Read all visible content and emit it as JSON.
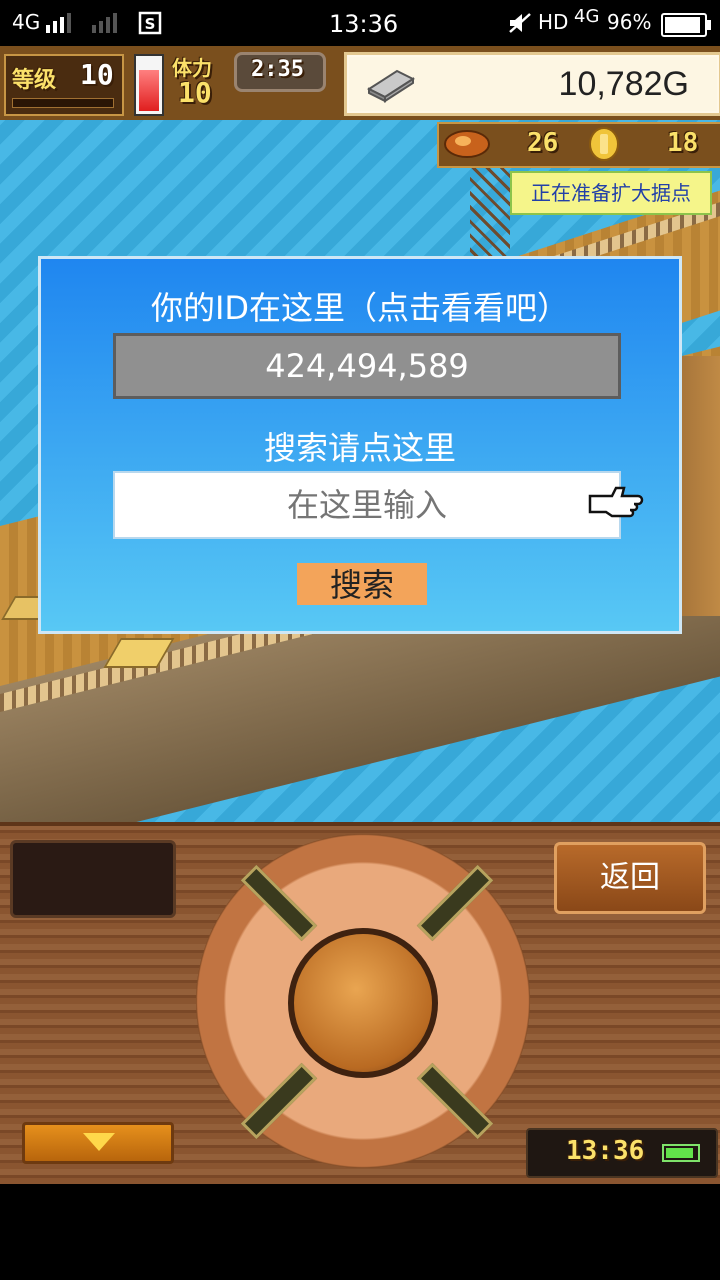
{
  "status_bar": {
    "network": "4G",
    "time": "13:36",
    "hd": "HD",
    "net2": "4G",
    "battery": "96%",
    "battery_level": 0.96
  },
  "hud": {
    "level_label": "等级",
    "level_value": "10",
    "stamina_label": "体力",
    "stamina_value": "10",
    "timer": "2:35",
    "gold": "10,782G",
    "resource1": "26",
    "resource2": "18",
    "notice": "正在准备扩大据点"
  },
  "dialog": {
    "title": "你的ID在这里（点击看看吧）",
    "id_value": "424,494,589",
    "search_label": "搜索请点这里",
    "search_placeholder": "在这里输入",
    "search_button": "搜索"
  },
  "panel": {
    "back_label": "返回",
    "clock": "13:36",
    "device_battery_level": 0.9
  },
  "colors": {
    "sea": "#37a8d8",
    "dialog_top": "#1f86f0",
    "dialog_bottom": "#58c8f4",
    "button": "#f3a45a",
    "wood": "#8a5530"
  }
}
